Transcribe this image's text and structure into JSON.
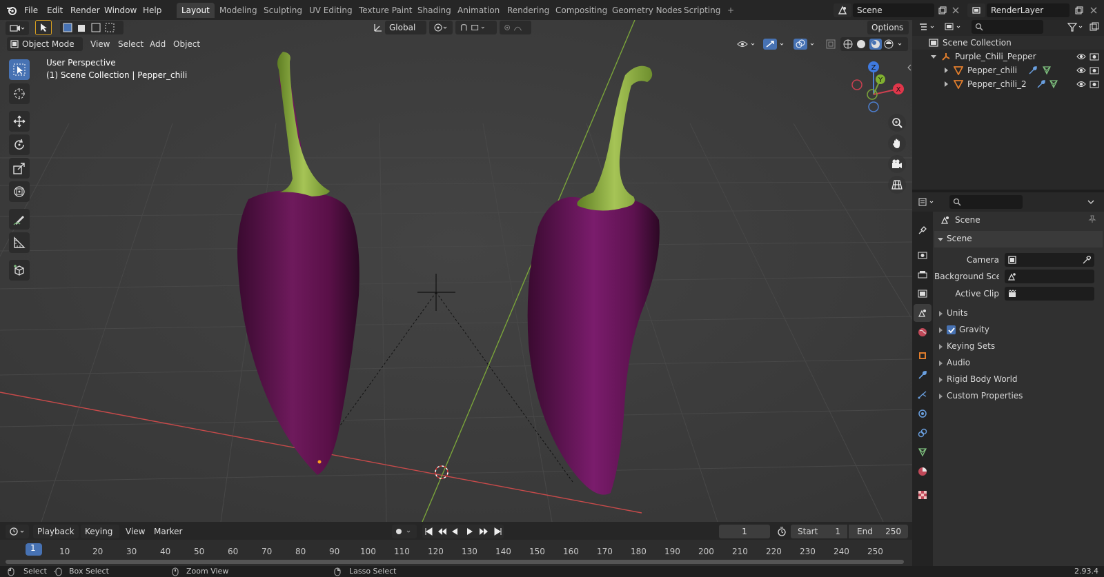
{
  "topbar": {
    "menus": [
      "File",
      "Edit",
      "Render",
      "Window",
      "Help"
    ],
    "workspaces": [
      "Layout",
      "Modeling",
      "Sculpting",
      "UV Editing",
      "Texture Paint",
      "Shading",
      "Animation",
      "Rendering",
      "Compositing",
      "Geometry Nodes",
      "Scripting"
    ],
    "active_workspace": "Layout",
    "add_tab": "+",
    "scene_name": "Scene",
    "view_layer": "RenderLayer"
  },
  "viewport": {
    "mode": "Object Mode",
    "menus": [
      "View",
      "Select",
      "Add",
      "Object"
    ],
    "transform_orientation": "Global",
    "options_label": "Options",
    "overlay_title": "User Perspective",
    "overlay_subtitle": "(1) Scene Collection | Pepper_chili",
    "gizmo": {
      "z": "Z",
      "y": "Y",
      "x": "X"
    }
  },
  "timeline": {
    "menus": [
      "Playback",
      "Keying",
      "View",
      "Marker"
    ],
    "current_frame": "1",
    "start_label": "Start",
    "start_value": "1",
    "end_label": "End",
    "end_value": "250",
    "ticks": [
      "1",
      "10",
      "20",
      "30",
      "40",
      "50",
      "60",
      "70",
      "80",
      "90",
      "100",
      "110",
      "120",
      "130",
      "140",
      "150",
      "160",
      "170",
      "180",
      "190",
      "200",
      "210",
      "220",
      "230",
      "240",
      "250"
    ]
  },
  "outliner": {
    "root": "Scene Collection",
    "collection": "Purple_Chili_Pepper",
    "objects": [
      "Pepper_chili",
      "Pepper_chili_2"
    ]
  },
  "properties": {
    "context": "Scene",
    "panel": "Scene",
    "camera_label": "Camera",
    "background_label": "Background Sce...",
    "clip_label": "Active Clip",
    "sections": [
      "Units",
      "Gravity",
      "Keying Sets",
      "Audio",
      "Rigid Body World",
      "Custom Properties"
    ],
    "gravity_checked": true
  },
  "statusbar": {
    "select": "Select",
    "box_select": "Box Select",
    "zoom_view": "Zoom View",
    "lasso_select": "Lasso Select",
    "version": "2.93.4"
  },
  "colors": {
    "accent": "#4772b3",
    "pepper": "#5a1048",
    "stem": "#8aac3c",
    "x_axis": "#c84a4a",
    "y_axis": "#7aa43a"
  }
}
